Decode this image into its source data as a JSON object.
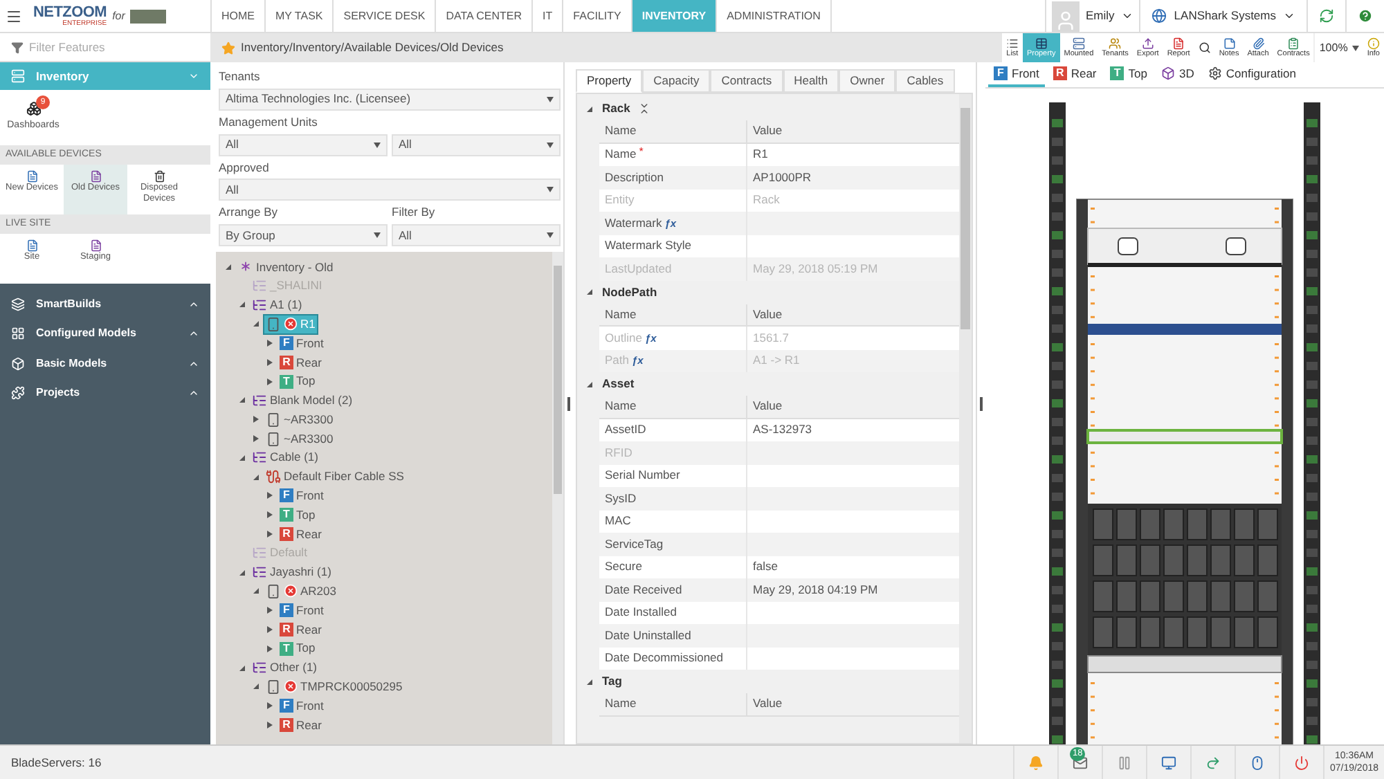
{
  "header": {
    "logo": {
      "brand": "NETZOOM",
      "edition": "ENTERPRISE",
      "for": "for"
    },
    "nav": [
      {
        "label": "HOME",
        "selected": false
      },
      {
        "label": "MY TASK",
        "selected": false
      },
      {
        "label": "SERVICE DESK",
        "selected": false
      },
      {
        "label": "DATA CENTER",
        "selected": false
      },
      {
        "label": "IT",
        "selected": false
      },
      {
        "label": "FACILITY",
        "selected": false
      },
      {
        "label": "INVENTORY",
        "selected": true
      },
      {
        "label": "ADMINISTRATION",
        "selected": false
      }
    ],
    "user": "Emily",
    "organization": "LANShark Systems"
  },
  "filter": {
    "placeholder": "Filter Features"
  },
  "breadcrumb": "Inventory/Inventory/Available Devices/Old Devices",
  "toolbar": [
    {
      "kind": "list",
      "label": "List",
      "selected": false
    },
    {
      "kind": "property",
      "label": "Property",
      "selected": true
    },
    {
      "kind": "mounted",
      "label": "Mounted",
      "selected": false
    },
    {
      "kind": "tenants",
      "label": "Tenants",
      "selected": false
    },
    {
      "kind": "export",
      "label": "Export",
      "selected": false
    },
    {
      "kind": "report",
      "label": "Report",
      "selected": false
    },
    {
      "kind": "search",
      "selected": false
    },
    {
      "kind": "notes",
      "label": "Notes",
      "selected": false
    },
    {
      "kind": "attach",
      "label": "Attach",
      "selected": false
    },
    {
      "kind": "contracts",
      "label": "Contracts",
      "selected": false
    },
    {
      "kind": "zoom",
      "label": "100%"
    },
    {
      "kind": "info",
      "label": "Info",
      "selected": false
    }
  ],
  "sidebar": {
    "header": {
      "label": "Inventory",
      "expanded": true
    },
    "dashboards": {
      "label": "Dashboards",
      "badge": "9"
    },
    "sections": [
      {
        "title": "AVAILABLE DEVICES",
        "items": [
          {
            "label": "New Devices",
            "kind": "new",
            "selected": false
          },
          {
            "label": "Old Devices",
            "kind": "old",
            "selected": true
          },
          {
            "label": "Disposed Devices",
            "kind": "disposed",
            "selected": false
          }
        ]
      },
      {
        "title": "LIVE SITE",
        "items": [
          {
            "label": "Site",
            "kind": "new",
            "selected": false
          },
          {
            "label": "Staging",
            "kind": "old",
            "selected": false
          }
        ]
      }
    ],
    "modules": [
      {
        "label": "SmartBuilds",
        "kind": "builds",
        "expanded": false
      },
      {
        "label": "Configured Models",
        "kind": "configured",
        "expanded": false
      },
      {
        "label": "Basic Models",
        "kind": "basic",
        "expanded": false
      },
      {
        "label": "Projects",
        "kind": "projects",
        "expanded": false
      }
    ]
  },
  "filters": {
    "tenants": {
      "label": "Tenants",
      "value": "Altima Technologies Inc. (Licensee)"
    },
    "management_units": {
      "label": "Management Units",
      "values": [
        "All",
        "All"
      ]
    },
    "approved": {
      "label": "Approved",
      "value": "All"
    },
    "arrange_by": {
      "label": "Arrange By",
      "value": "By Group"
    },
    "filter_by": {
      "label": "Filter By",
      "value": "All"
    }
  },
  "tree": [
    {
      "label": "Inventory - Old",
      "kind": "root",
      "expanded": true,
      "children": [
        {
          "label": "_SHALINI",
          "kind": "group",
          "muted": true
        },
        {
          "label": "A1 (1)",
          "kind": "group",
          "expanded": true,
          "children": [
            {
              "label": "R1",
              "kind": "device",
              "error": true,
              "selected": true,
              "expanded": true,
              "children": [
                {
                  "label": "Front",
                  "kind": "view",
                  "badge": "F",
                  "color": "#2f7ec2",
                  "expanded": false
                },
                {
                  "label": "Rear",
                  "kind": "view",
                  "badge": "R",
                  "color": "#d9483b",
                  "expanded": false
                },
                {
                  "label": "Top",
                  "kind": "view",
                  "badge": "T",
                  "color": "#3fae84",
                  "expanded": false
                }
              ]
            }
          ]
        },
        {
          "label": "Blank Model (2)",
          "kind": "group",
          "expanded": true,
          "children": [
            {
              "label": "~AR3300",
              "kind": "device",
              "error": false,
              "expanded": false
            },
            {
              "label": "~AR3300",
              "kind": "device",
              "error": false,
              "expanded": false
            }
          ]
        },
        {
          "label": "Cable (1)",
          "kind": "group",
          "expanded": true,
          "children": [
            {
              "label": "Default Fiber Cable SS",
              "kind": "cable",
              "expanded": true,
              "children": [
                {
                  "label": "Front",
                  "kind": "view",
                  "badge": "F",
                  "color": "#2f7ec2",
                  "expanded": false
                },
                {
                  "label": "Top",
                  "kind": "view",
                  "badge": "T",
                  "color": "#3fae84",
                  "expanded": false
                },
                {
                  "label": "Rear",
                  "kind": "view",
                  "badge": "R",
                  "color": "#d9483b",
                  "expanded": false
                }
              ]
            }
          ]
        },
        {
          "label": "Default",
          "kind": "group",
          "muted": true
        },
        {
          "label": "Jayashri (1)",
          "kind": "group",
          "expanded": true,
          "children": [
            {
              "label": "AR203",
              "kind": "device",
              "error": true,
              "expanded": true,
              "children": [
                {
                  "label": "Front",
                  "kind": "view",
                  "badge": "F",
                  "color": "#2f7ec2",
                  "expanded": false
                },
                {
                  "label": "Rear",
                  "kind": "view",
                  "badge": "R",
                  "color": "#d9483b",
                  "expanded": false
                },
                {
                  "label": "Top",
                  "kind": "view",
                  "badge": "T",
                  "color": "#3fae84",
                  "expanded": false
                }
              ]
            }
          ]
        },
        {
          "label": "Other (1)",
          "kind": "group",
          "expanded": true,
          "children": [
            {
              "label": "TMPRCK00050295",
              "kind": "device",
              "error": true,
              "expanded": true,
              "children": [
                {
                  "label": "Front",
                  "kind": "view",
                  "badge": "F",
                  "color": "#2f7ec2",
                  "expanded": false
                },
                {
                  "label": "Rear",
                  "kind": "view",
                  "badge": "R",
                  "color": "#d9483b",
                  "expanded": false
                }
              ]
            }
          ]
        }
      ]
    }
  ],
  "property_tabs": [
    {
      "label": "Property",
      "selected": true
    },
    {
      "label": "Capacity",
      "selected": false
    },
    {
      "label": "Contracts",
      "selected": false
    },
    {
      "label": "Health",
      "selected": false
    },
    {
      "label": "Owner",
      "selected": false
    },
    {
      "label": "Cables",
      "selected": false
    }
  ],
  "property_sections": [
    {
      "title": "Rack",
      "expanded": true,
      "columns": [
        "Name",
        "Value"
      ],
      "rows": [
        {
          "name": "Name",
          "required_mark": "*",
          "value": "R1",
          "disabled": false
        },
        {
          "name": "Description",
          "value": "AP1000PR",
          "disabled": false
        },
        {
          "name": "Entity",
          "value": "Rack",
          "disabled": true
        },
        {
          "name": "Watermark",
          "fx": "ƒx",
          "value": "",
          "disabled": false
        },
        {
          "name": "Watermark Style",
          "value": "",
          "disabled": false
        },
        {
          "name": "LastUpdated",
          "value": "May 29, 2018 05:19 PM",
          "disabled": true
        }
      ]
    },
    {
      "title": "NodePath",
      "expanded": true,
      "columns": [
        "Name",
        "Value"
      ],
      "rows": [
        {
          "name": "Outline",
          "fx": "ƒx",
          "value": "1561.7",
          "disabled": true
        },
        {
          "name": "Path",
          "fx": "ƒx",
          "value": "A1 -> R1",
          "disabled": true
        }
      ]
    },
    {
      "title": "Asset",
      "expanded": true,
      "columns": [
        "Name",
        "Value"
      ],
      "rows": [
        {
          "name": "AssetID",
          "value": "AS-132973",
          "disabled": false
        },
        {
          "name": "RFID",
          "value": "",
          "disabled": true
        },
        {
          "name": "Serial Number",
          "value": "",
          "disabled": false
        },
        {
          "name": "SysID",
          "value": "",
          "disabled": false
        },
        {
          "name": "MAC",
          "value": "",
          "disabled": false
        },
        {
          "name": "ServiceTag",
          "value": "",
          "disabled": false
        },
        {
          "name": "Secure",
          "value": "false",
          "disabled": false
        },
        {
          "name": "Date Received",
          "value": "May 29, 2018 04:19 PM",
          "disabled": false
        },
        {
          "name": "Date Installed",
          "value": "",
          "disabled": false
        },
        {
          "name": "Date Uninstalled",
          "value": "",
          "disabled": false
        },
        {
          "name": "Date Decommissioned",
          "value": "",
          "disabled": false
        }
      ]
    },
    {
      "title": "Tag",
      "expanded": true,
      "columns": [
        "Name",
        "Value"
      ]
    }
  ],
  "view_tabs": [
    {
      "label": "Front",
      "badge": "F",
      "color": "#2f7ec2",
      "selected": true
    },
    {
      "label": "Rear",
      "badge": "R",
      "color": "#d9483b",
      "selected": false
    },
    {
      "label": "Top",
      "badge": "T",
      "color": "#3fae84",
      "selected": false
    },
    {
      "label": "3D",
      "kind": "cube",
      "selected": false
    },
    {
      "label": "Configuration",
      "kind": "gear",
      "selected": false
    }
  ],
  "status_bar": {
    "text": "BladeServers: 16",
    "mail_count": "18",
    "time": "10:36AM",
    "date": "07/19/2018"
  }
}
